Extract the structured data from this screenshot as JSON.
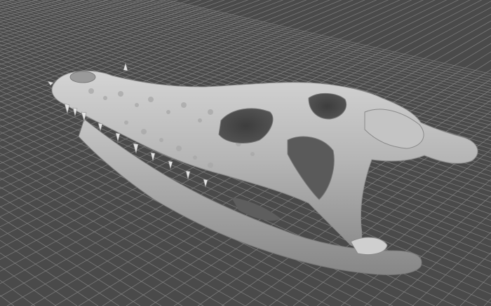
{
  "viewer": {
    "background_color": "#4a4a4a",
    "grid_color": "#8a8a8a",
    "model_color": "#bdbdbd",
    "grid": true,
    "model": "alligator-skull-scan"
  }
}
